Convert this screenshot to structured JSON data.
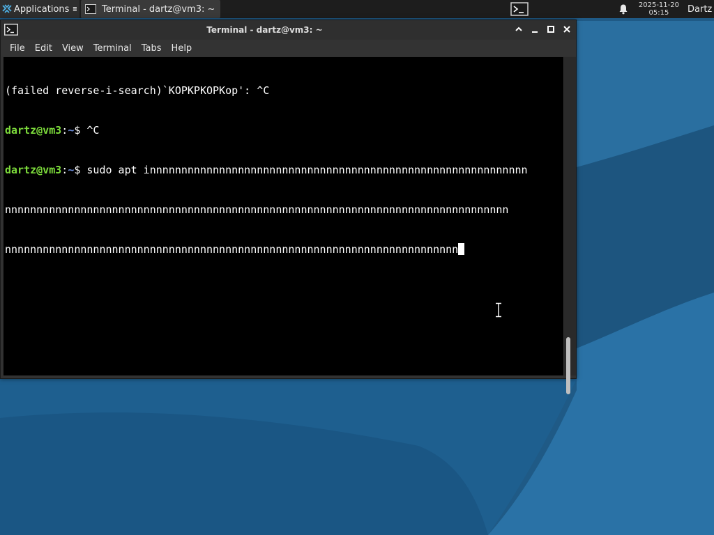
{
  "panel": {
    "applications_label": "Applications ≡",
    "task_label": "Terminal - dartz@vm3: ~",
    "clock_date": "2025-11-20",
    "clock_time": "05:15",
    "user_label": "Dartz",
    "icons": [
      "xfce-logo-icon",
      "terminal-icon",
      "bell-icon"
    ]
  },
  "window": {
    "title": "Terminal - dartz@vm3: ~",
    "menu": [
      "File",
      "Edit",
      "View",
      "Terminal",
      "Tabs",
      "Help"
    ]
  },
  "terminal": {
    "line1": "(failed reverse-i-search)`KOPKPKOPKop': ^C",
    "prompt_user": "dartz@vm3",
    "prompt_colon": ":",
    "prompt_path": "~",
    "prompt_dollar": "$ ",
    "line2_cmd": "^C",
    "line3_cmd": "sudo apt innnnnnnnnnnnnnnnnnnnnnnnnnnnnnnnnnnnnnnnnnnnnnnnnnnnnnnnnnnn",
    "line4": "nnnnnnnnnnnnnnnnnnnnnnnnnnnnnnnnnnnnnnnnnnnnnnnnnnnnnnnnnnnnnnnnnnnnnnnnnnnnnnnn",
    "line5": "nnnnnnnnnnnnnnnnnnnnnnnnnnnnnnnnnnnnnnnnnnnnnnnnnnnnnnnnnnnnnnnnnnnnnnnn"
  },
  "colors": {
    "prompt_user": "#7ddc3b",
    "prompt_path": "#6a8ad8",
    "desktop_bg": "#1f5a86"
  }
}
